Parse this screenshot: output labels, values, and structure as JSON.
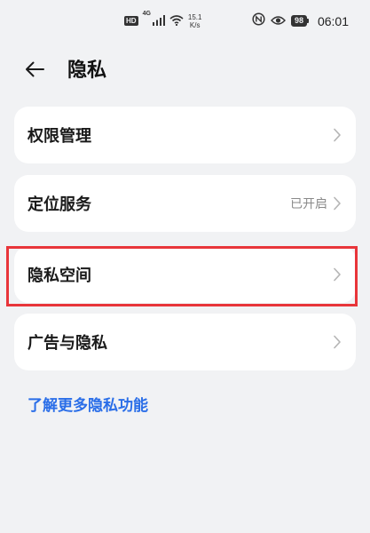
{
  "status_bar": {
    "hd_badge": "HD",
    "network_type": "4G",
    "speed_value": "15.1",
    "speed_unit": "K/s",
    "battery_level": "98",
    "time": "06:01"
  },
  "header": {
    "title": "隐私"
  },
  "menu": {
    "items": [
      {
        "label": "权限管理",
        "value": ""
      },
      {
        "label": "定位服务",
        "value": "已开启"
      },
      {
        "label": "隐私空间",
        "value": ""
      },
      {
        "label": "广告与隐私",
        "value": ""
      }
    ]
  },
  "footer_link": {
    "label": "了解更多隐私功能"
  },
  "colors": {
    "background": "#f1f2f4",
    "card": "#ffffff",
    "link": "#2a6ee8",
    "highlight": "#e8353a"
  }
}
